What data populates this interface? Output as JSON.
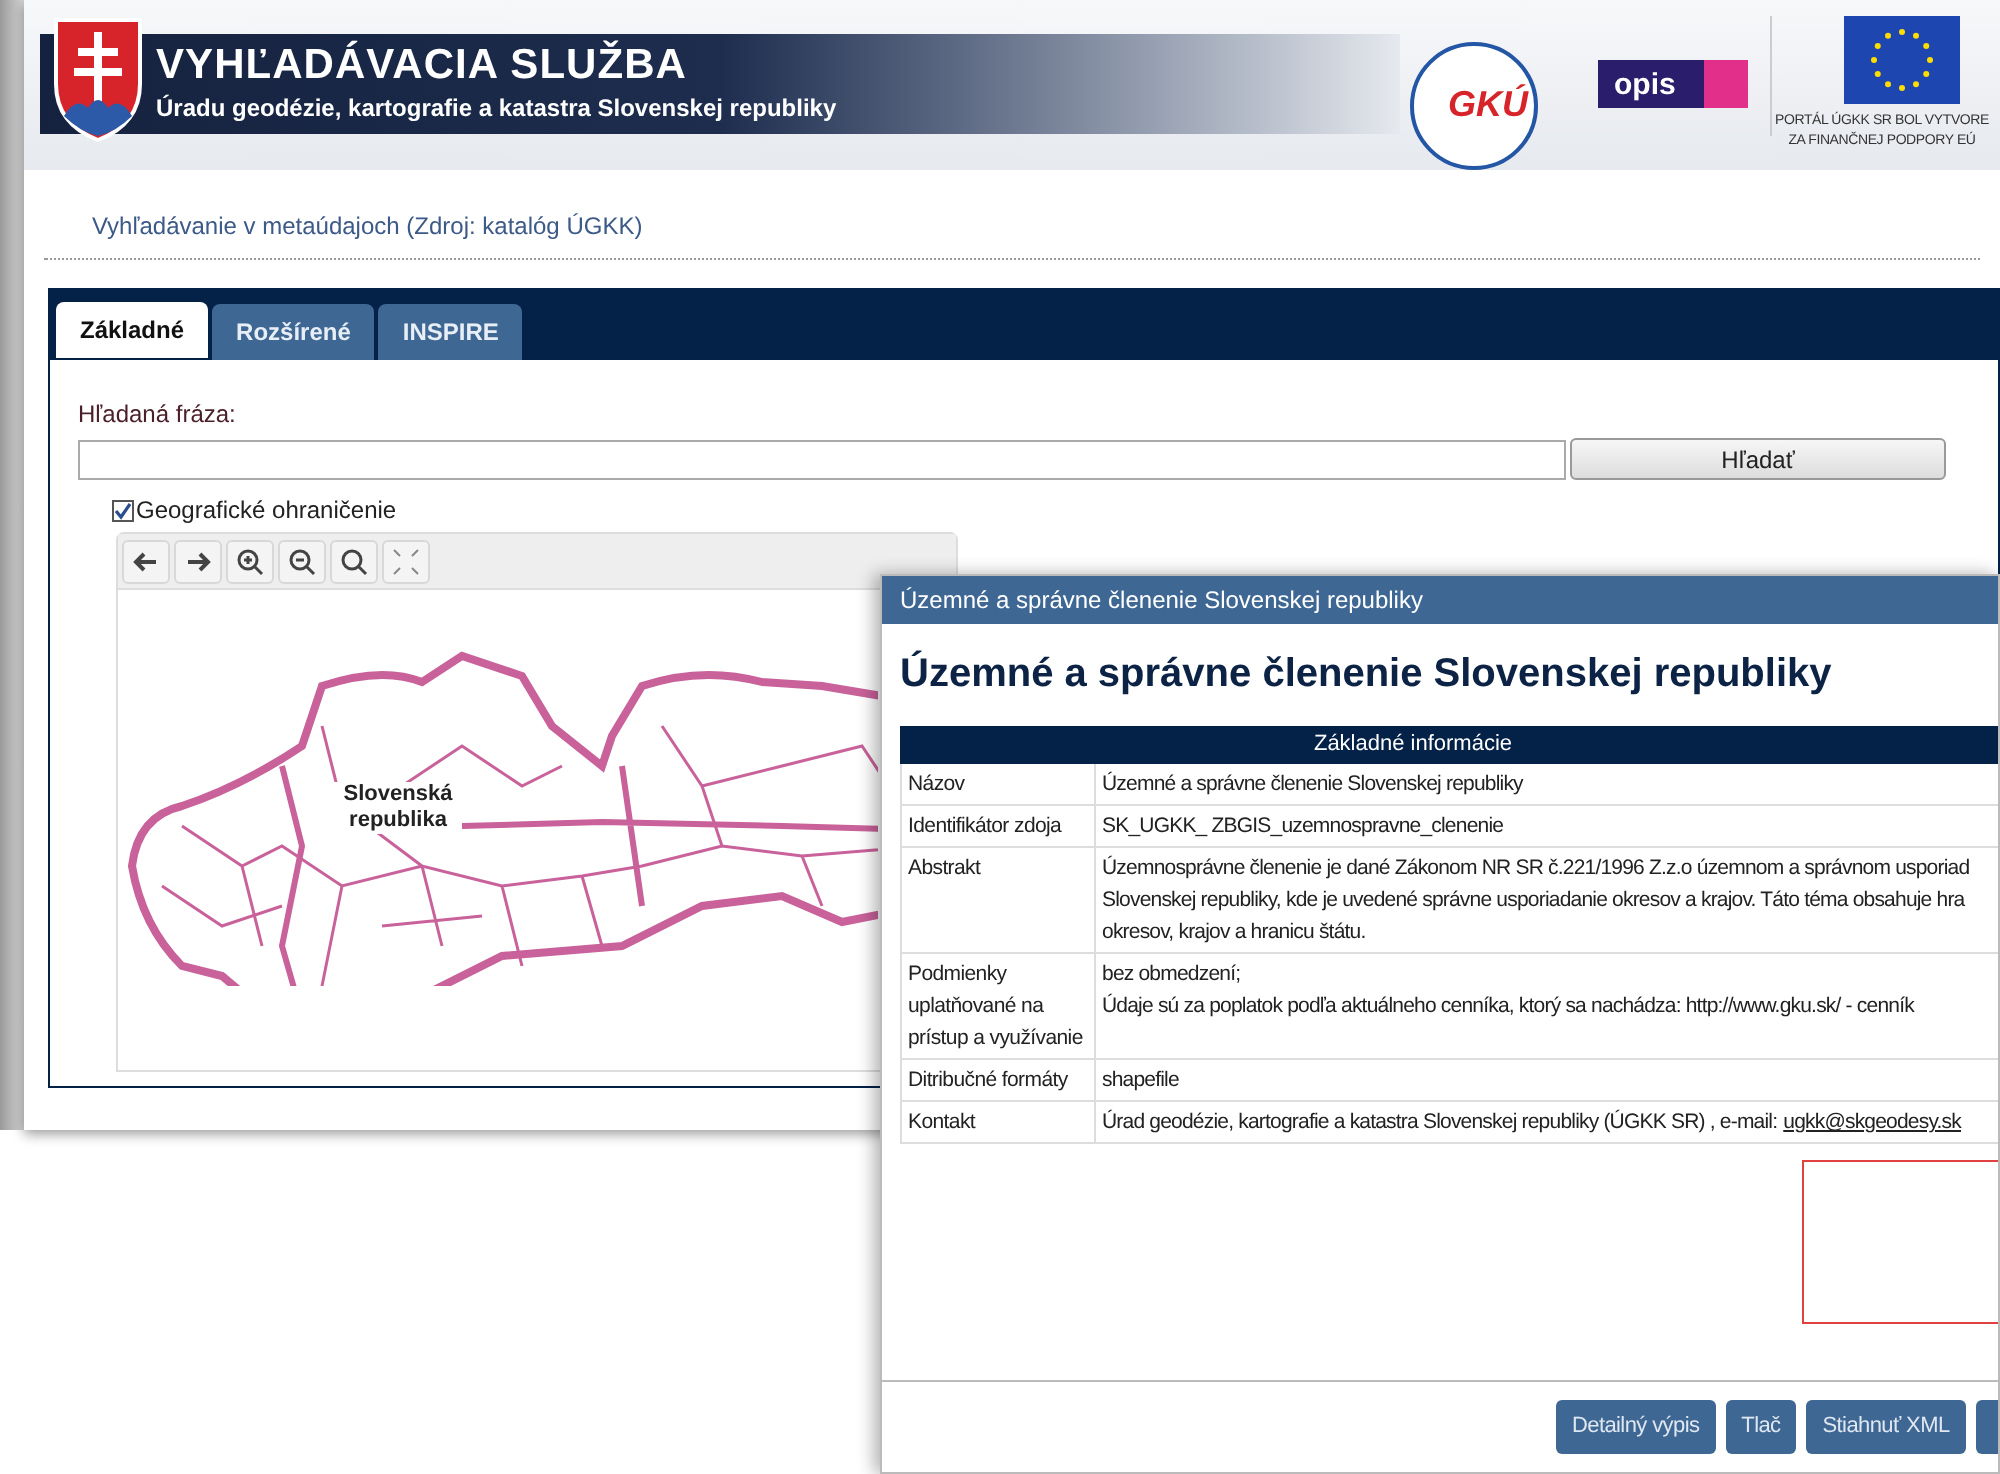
{
  "header": {
    "title": "VYHĽADÁVACIA SLUŽBA",
    "subtitle": "Úradu geodézie, kartografie a katastra Slovenskej republiky",
    "gku_logo": "GKÚ",
    "opis_logo": "opis",
    "eu_note": [
      "PORTÁL ÚGKK SR BOL VYTVORE",
      "ZA FINANČNEJ PODPORY EÚ"
    ]
  },
  "breadcrumb": "Vyhľadávanie v metaúdajoch (Zdroj: katalóg ÚGKK)",
  "tabs": [
    {
      "label": "Základné",
      "selected": true
    },
    {
      "label": "Rozšírené",
      "selected": false
    },
    {
      "label": "INSPIRE",
      "selected": false
    }
  ],
  "search": {
    "label": "Hľadaná fráza:",
    "button": "Hľadať"
  },
  "geo_filter": {
    "label": "Geografické ohraničenie",
    "checked": true
  },
  "map": {
    "label": "Slovenská republika"
  },
  "dialog": {
    "title": "Územné a správne členenie Slovenskej republiky",
    "heading": "Územné a správne členenie Slovenskej republiky",
    "table": {
      "header": "Základné informácie",
      "rows": [
        {
          "label": "Názov",
          "lines": [
            "Územné a správne členenie Slovenskej republiky"
          ]
        },
        {
          "label": "Identifikátor zdoja",
          "lines": [
            "SK_UGKK_ ZBGIS_uzemnospravne_clenenie"
          ]
        },
        {
          "label": "Abstrakt",
          "lines": [
            "Územnosprávne členenie je dané Zákonom NR SR č.221/1996 Z.z.o územnom a správnom usporiad",
            "Slovenskej republiky, kde je uvedené správne usporiadanie okresov a krajov. Táto téma obsahuje hra",
            "okresov, krajov a hranicu štátu."
          ]
        },
        {
          "label": "Podmienky uplatňované na prístup a využívanie",
          "lines": [
            "bez obmedzení;",
            "Údaje sú za poplatok podľa aktuálneho cenníka, ktorý sa nachádza: http://www.gku.sk/ - cenník"
          ]
        },
        {
          "label": "Ditribučné formáty",
          "lines": [
            "shapefile"
          ]
        },
        {
          "label": "Kontakt",
          "lines": [
            "Úrad geodézie, kartografie a katastra Slovenskej republiky (ÚGKK SR) , e-mail:"
          ],
          "link": "ugkk@skgeodesy.sk"
        }
      ]
    },
    "buttons": [
      "Detailný výpis",
      "Tlač",
      "Stiahnuť XML"
    ]
  }
}
